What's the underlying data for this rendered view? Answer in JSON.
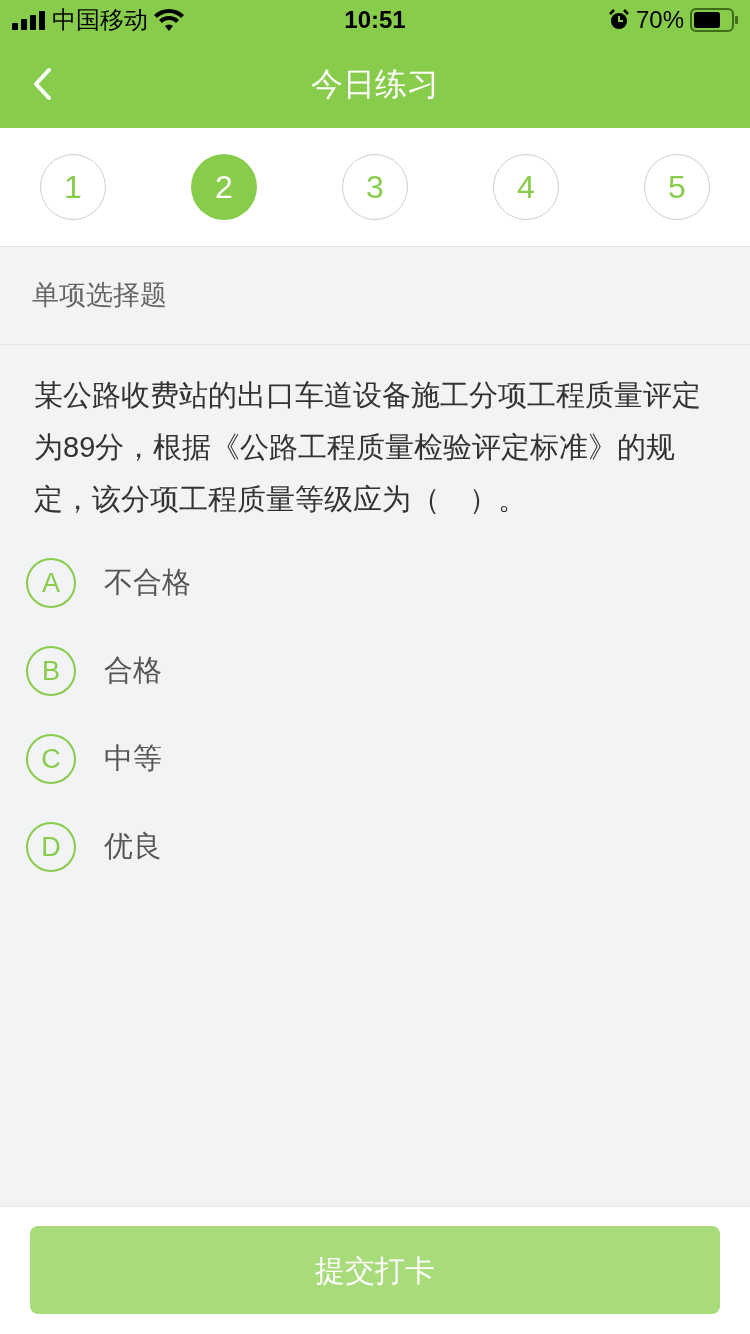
{
  "status_bar": {
    "carrier": "中国移动",
    "time": "10:51",
    "battery": "70%"
  },
  "nav": {
    "title": "今日练习"
  },
  "question_tabs": [
    {
      "label": "1",
      "selected": false
    },
    {
      "label": "2",
      "selected": true
    },
    {
      "label": "3",
      "selected": false
    },
    {
      "label": "4",
      "selected": false
    },
    {
      "label": "5",
      "selected": false
    }
  ],
  "question_type": "单项选择题",
  "question": "某公路收费站的出口车道设备施工分项工程质量评定为89分，根据《公路工程质量检验评定标准》的规定，该分项工程质量等级应为（　）。",
  "options": [
    {
      "letter": "A",
      "text": "不合格",
      "selected": false
    },
    {
      "letter": "B",
      "text": "合格",
      "selected": false
    },
    {
      "letter": "C",
      "text": "中等",
      "selected": false
    },
    {
      "letter": "D",
      "text": "优良",
      "selected": false
    }
  ],
  "submit": {
    "label": "提交打卡",
    "disabled": true
  }
}
